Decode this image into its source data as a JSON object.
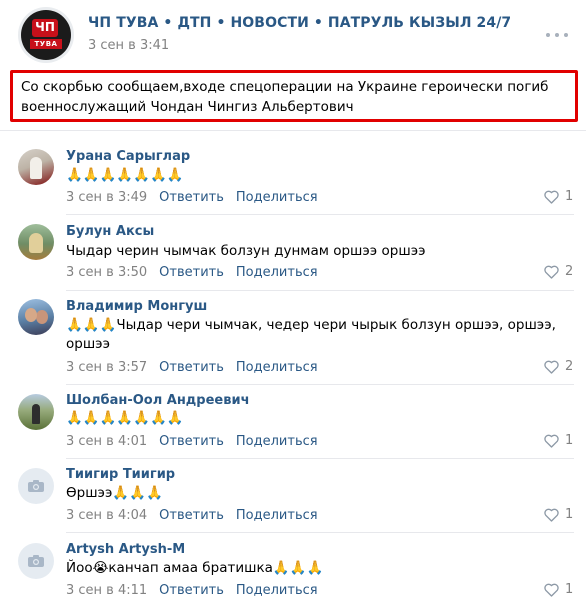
{
  "post": {
    "group_name": "ЧП ТУВА • ДТП • НОВОСТИ • ПАТРУЛЬ КЫЗЫЛ 24/7",
    "time": "3 сен в 3:41",
    "logo_text": "ТУВА",
    "logo_mark": "ЧП",
    "text": "Со скорбью сообщаем,входе спецоперации на Украине героически погиб военнослужащий Чондан Чингиз Альбертович",
    "highlight_color": "#e10000",
    "icons": {
      "more": "more-horizontal-icon"
    }
  },
  "comment_actions": {
    "reply": "Ответить",
    "share": "Поделиться"
  },
  "comments": [
    {
      "author": "Урана Сарыглар",
      "text": "🙏🙏🙏🙏🙏🙏🙏",
      "time": "3 сен в 3:49",
      "likes": "1"
    },
    {
      "author": "Булун Аксы",
      "text": "Чыдар черин чымчак болзун дунмам оршээ оршээ",
      "time": "3 сен в 3:50",
      "likes": "2"
    },
    {
      "author": "Владимир Монгуш",
      "text": "🙏🙏🙏Чыдар чери чымчак, чедер чери чырык болзун оршээ, оршээ, оршээ",
      "time": "3 сен в 3:57",
      "likes": "2"
    },
    {
      "author": "Шолбан-Оол Андреевич",
      "text": "🙏🙏🙏🙏🙏🙏🙏",
      "time": "3 сен в 4:01",
      "likes": "1"
    },
    {
      "author": "Тиигир Тиигир",
      "text": "Өршээ🙏🙏🙏",
      "time": "3 сен в 4:04",
      "likes": "1"
    },
    {
      "author": "Artysh Artysh-M",
      "text": "Йоо😭канчап амаа братишка🙏🙏🙏",
      "time": "3 сен в 4:11",
      "likes": "1"
    }
  ],
  "colors": {
    "link": "#2a5885",
    "meta": "#828282",
    "divider": "#e7e8ec"
  }
}
